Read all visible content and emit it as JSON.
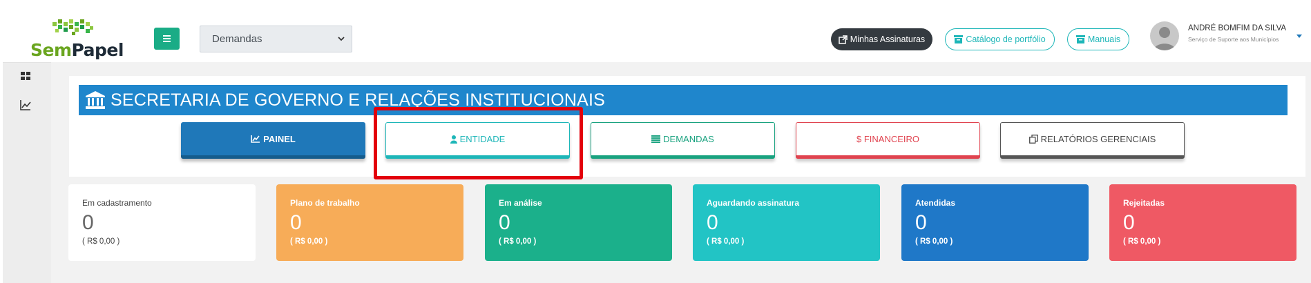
{
  "header": {
    "logo_text_1": "Sem",
    "logo_text_2": "Papel",
    "module_select": {
      "value": "Demandas"
    },
    "buttons": {
      "assinaturas": "Minhas Assinaturas",
      "catalogo": "Catálogo de portfólio",
      "manuais": "Manuais"
    },
    "user": {
      "name": "ANDRÉ BOMFIM DA SILVA",
      "organization": "Serviço de Suporte aos Municípios"
    }
  },
  "sidebar": {
    "items": [
      {
        "icon": "grid-icon"
      },
      {
        "icon": "line-chart-icon"
      }
    ]
  },
  "secretaria": {
    "title": "SECRETARIA DE GOVERNO E RELAÇÕES INSTITUCIONAIS",
    "icon": "institution-icon"
  },
  "nav": {
    "painel": "PAINEL",
    "entidade": "ENTIDADE",
    "demandas": "DEMANDAS",
    "financeiro": "$ FINANCEIRO",
    "relatorios": "RELATÓRIOS GERENCIAIS"
  },
  "cards": [
    {
      "label": "Em cadastramento",
      "count": "0",
      "value": "( R$ 0,00 )"
    },
    {
      "label": "Plano de trabalho",
      "count": "0",
      "value": "( R$ 0,00 )"
    },
    {
      "label": "Em análise",
      "count": "0",
      "value": "( R$ 0,00 )"
    },
    {
      "label": "Aguardando assinatura",
      "count": "0",
      "value": "( R$ 0,00 )"
    },
    {
      "label": "Atendidas",
      "count": "0",
      "value": "( R$ 0,00 )"
    },
    {
      "label": "Rejeitadas",
      "count": "0",
      "value": "( R$ 0,00 )"
    }
  ],
  "colors": {
    "primary_blue": "#1f78b9",
    "teal": "#1db6b8",
    "green": "#19a27f",
    "red": "#e0434f",
    "orange": "#f7ac58",
    "highlight_red": "#e3000b"
  }
}
